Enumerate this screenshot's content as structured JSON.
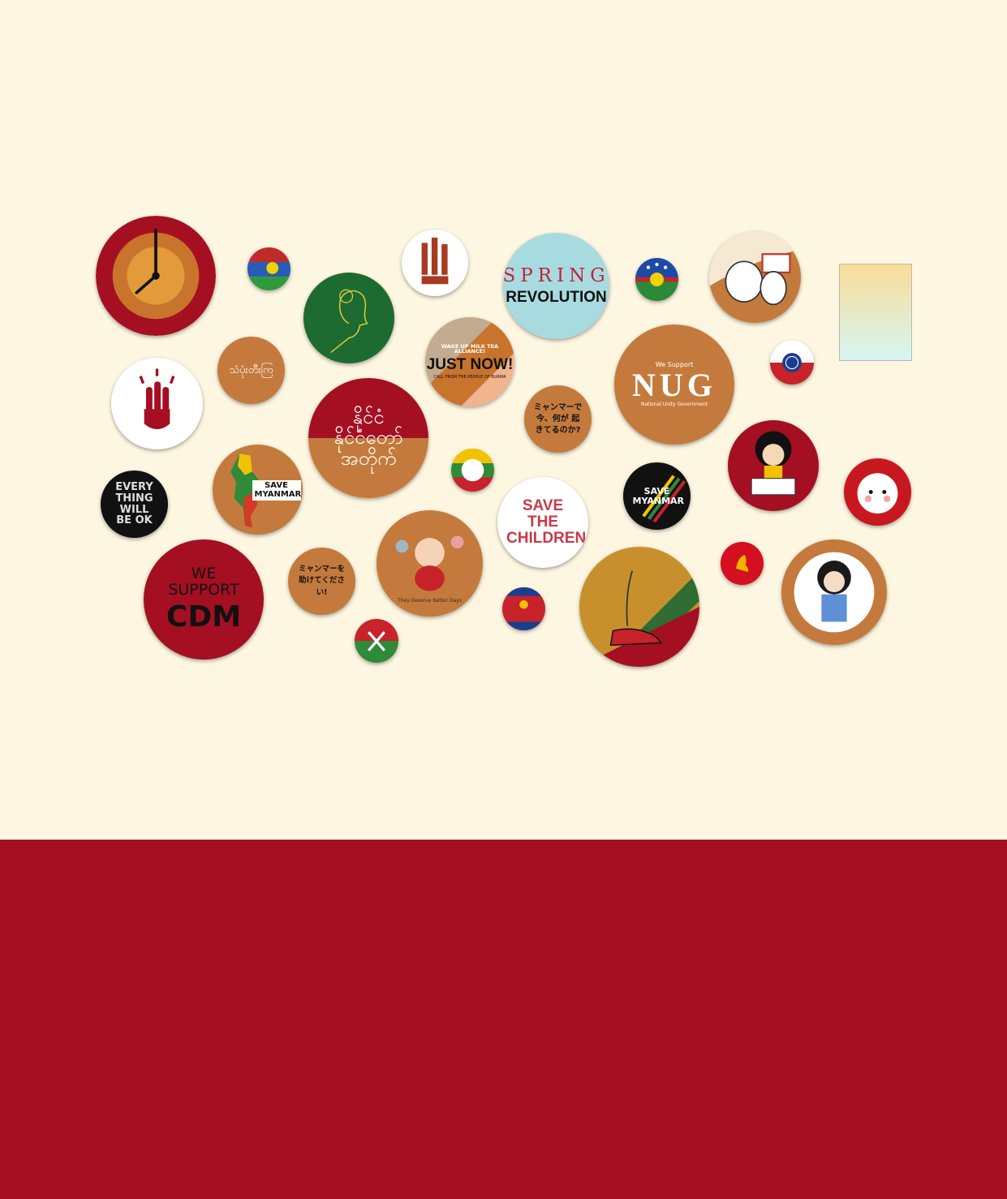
{
  "badges": {
    "spring_line1": "SPRING",
    "spring_line2": "REVOLUTION",
    "milk_tea_top": "WAKE UP MILK TEA ALLIANCE!",
    "milk_tea_main": "JUST NOW!",
    "milk_tea_bottom": "CALL FROM THE PEOPLE OF BURMA",
    "nug_top": "We Support",
    "nug_main": "NUG",
    "nug_bottom": "National Unity Government",
    "jp_question": "ミャンマーで 今、何が 起きてるのか?",
    "save_myanmar_map": "SAVE MYANMAR",
    "save_myanmar_dark": "SAVE MYANMAR",
    "everything_ok": "EVERY THING WILL BE OK",
    "save_children": "SAVE THE CHILDREN",
    "we_support_cdm_1": "WE SUPPORT",
    "we_support_cdm_2": "CDM",
    "jp_help": "ミャンマーを 助けてください!",
    "better_days": "They Deserve Better Days",
    "burmese_small": "သံပုံးတီးကြ",
    "burmese_large": "နိုင်ငံ နိုင်ငံတော် အတိုက်"
  },
  "colors": {
    "cream": "#fdf6e0",
    "crimson": "#a50f22",
    "ochre": "#c47a3c",
    "green": "#1e6b31"
  }
}
